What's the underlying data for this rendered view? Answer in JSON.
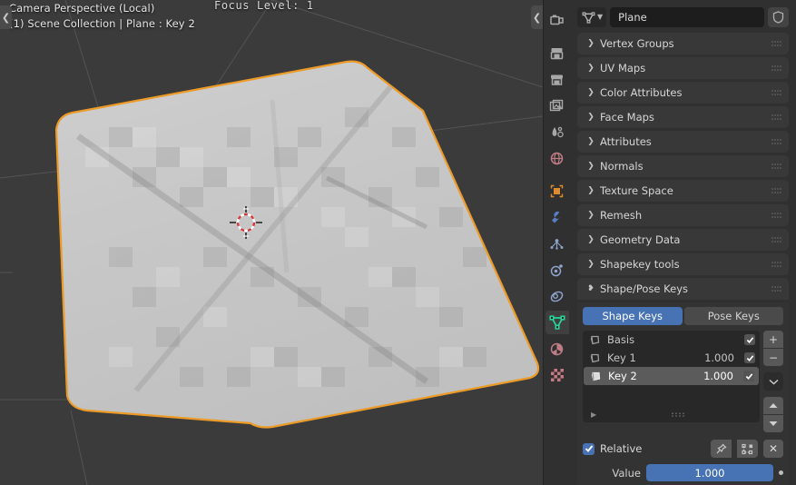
{
  "viewport": {
    "overlay_line1": "Camera Perspective (Local)",
    "overlay_line2": "(1) Scene Collection | Plane : Key 2",
    "focus_level": "Focus Level: 1",
    "left_arrow": "❮",
    "right_arrow": "❮",
    "background_color": "#3b3b3b",
    "selection_outline_color": "#ed9b28",
    "mesh_color": "#c9c9c9"
  },
  "tab_rail": {
    "tabs": [
      {
        "name": "tool-tab",
        "icon": "tool-icon",
        "active": false
      },
      {
        "name": "render-tab",
        "icon": "render-camera-icon",
        "active": false
      },
      {
        "name": "output-tab",
        "icon": "printer-icon",
        "active": false
      },
      {
        "name": "view-layer-tab",
        "icon": "images-icon",
        "active": false
      },
      {
        "name": "scene-tab",
        "icon": "scene-cone-icon",
        "active": false
      },
      {
        "name": "world-tab",
        "icon": "world-globe-icon",
        "active": false
      },
      {
        "name": "object-tab",
        "icon": "object-square-icon",
        "active": false
      },
      {
        "name": "modifier-tab",
        "icon": "wrench-icon",
        "active": false
      },
      {
        "name": "particles-tab",
        "icon": "particles-icon",
        "active": false
      },
      {
        "name": "physics-tab",
        "icon": "physics-orbit-icon",
        "active": false
      },
      {
        "name": "constraints-tab",
        "icon": "constraint-icon",
        "active": false
      },
      {
        "name": "data-tab",
        "icon": "mesh-data-triangle-icon",
        "active": true
      },
      {
        "name": "material-tab",
        "icon": "material-sphere-icon",
        "active": false
      },
      {
        "name": "texture-tab",
        "icon": "texture-checker-icon",
        "active": false
      }
    ]
  },
  "properties": {
    "breadcrumb": {
      "datablock_icon": "mesh-data-triangle-icon",
      "dropdown_chevron": "▼",
      "name": "Plane",
      "shield_icon": "shield-icon"
    },
    "panels": [
      {
        "label": "Vertex Groups",
        "expanded": false
      },
      {
        "label": "UV Maps",
        "expanded": false
      },
      {
        "label": "Color Attributes",
        "expanded": false
      },
      {
        "label": "Face Maps",
        "expanded": false
      },
      {
        "label": "Attributes",
        "expanded": false
      },
      {
        "label": "Normals",
        "expanded": false
      },
      {
        "label": "Texture Space",
        "expanded": false
      },
      {
        "label": "Remesh",
        "expanded": false
      },
      {
        "label": "Geometry Data",
        "expanded": false
      },
      {
        "label": "Shapekey tools",
        "expanded": false
      },
      {
        "label": "Shape/Pose Keys",
        "expanded": true
      }
    ],
    "shape_pose_keys": {
      "tabs": [
        {
          "label": "Shape Keys",
          "active": true
        },
        {
          "label": "Pose Keys",
          "active": false
        }
      ],
      "columns": [
        "name",
        "value",
        "mute"
      ],
      "keys": [
        {
          "icon": "shapekey-icon",
          "name": "Basis",
          "value": "",
          "enabled": true,
          "selected": false
        },
        {
          "icon": "shapekey-icon",
          "name": "Key 1",
          "value": "1.000",
          "enabled": true,
          "selected": false
        },
        {
          "icon": "shapekey-icon",
          "name": "Key 2",
          "value": "1.000",
          "enabled": true,
          "selected": true
        }
      ],
      "side_buttons": [
        {
          "name": "add-shapekey-button",
          "label": "+"
        },
        {
          "name": "remove-shapekey-button",
          "label": "−"
        },
        {
          "name": "shapekey-specials-button",
          "label": "⌄"
        },
        {
          "name": "move-shapekey-up-button",
          "label": "▲"
        },
        {
          "name": "move-shapekey-down-button",
          "label": "▼"
        }
      ],
      "relative": {
        "label": "Relative",
        "checked": true
      },
      "pin_icon": "pin-icon",
      "edit_mode_icon": "edit-mode-icon",
      "close_label": "✕",
      "value": {
        "label": "Value",
        "display": "1.000",
        "fill_percent": 100
      },
      "accent_color": "#4772b3"
    }
  }
}
